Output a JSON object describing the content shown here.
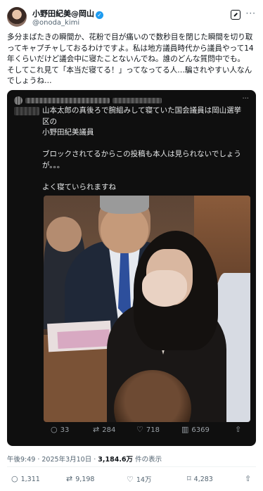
{
  "author": {
    "display_name": "小野田紀美@岡山",
    "verified_mark": "✓",
    "handle": "@onoda_kimi"
  },
  "tweet": {
    "lines": [
      "多分まばたきの瞬間か、花粉で目が痛いので数秒目を閉じた瞬間を切り取",
      "ってキャプチャしておるわけですよ。私は地方議員時代から議員やって14",
      "年くらいだけど議会中に寝たことないんでね。誰のどんな質問中でも。",
      "そしてこれ見て「本当だ寝てる！」ってなってる人…騙されやすい人なん",
      "でしょうね…"
    ]
  },
  "quote": {
    "lines": [
      "山本太郎の真後ろで腕組みして寝ていた国会議員は岡山選挙",
      "区の",
      "小野田紀美議員",
      "",
      "ブロックされてるからこの投稿も本人は見られないでしょう",
      "が。。。",
      "",
      "よく寝ていられますね"
    ],
    "more_label": "···",
    "actions": [
      {
        "icon": "○",
        "name": "reply-icon",
        "count": "33"
      },
      {
        "icon": "⇄",
        "name": "retweet-icon",
        "count": "284"
      },
      {
        "icon": "♡",
        "name": "like-icon",
        "count": "718"
      },
      {
        "icon": "▥",
        "name": "views-icon",
        "count": "6369"
      },
      {
        "icon": "⇧",
        "name": "share-icon",
        "count": ""
      }
    ]
  },
  "meta": {
    "time": "午後9:49 · 2025年3月10日 · ",
    "views": "3,184.6万",
    "views_suffix": " 件の表示"
  },
  "actions": [
    {
      "icon": "○",
      "name": "reply-icon",
      "count": "1,311"
    },
    {
      "icon": "⇄",
      "name": "retweet-icon",
      "count": "9,198"
    },
    {
      "icon": "♡",
      "name": "like-icon",
      "count": "14万"
    },
    {
      "icon": "⌑",
      "name": "bookmark-icon",
      "count": "4,283"
    },
    {
      "icon": "⇧",
      "name": "share-icon",
      "count": ""
    }
  ],
  "header_more": "···"
}
